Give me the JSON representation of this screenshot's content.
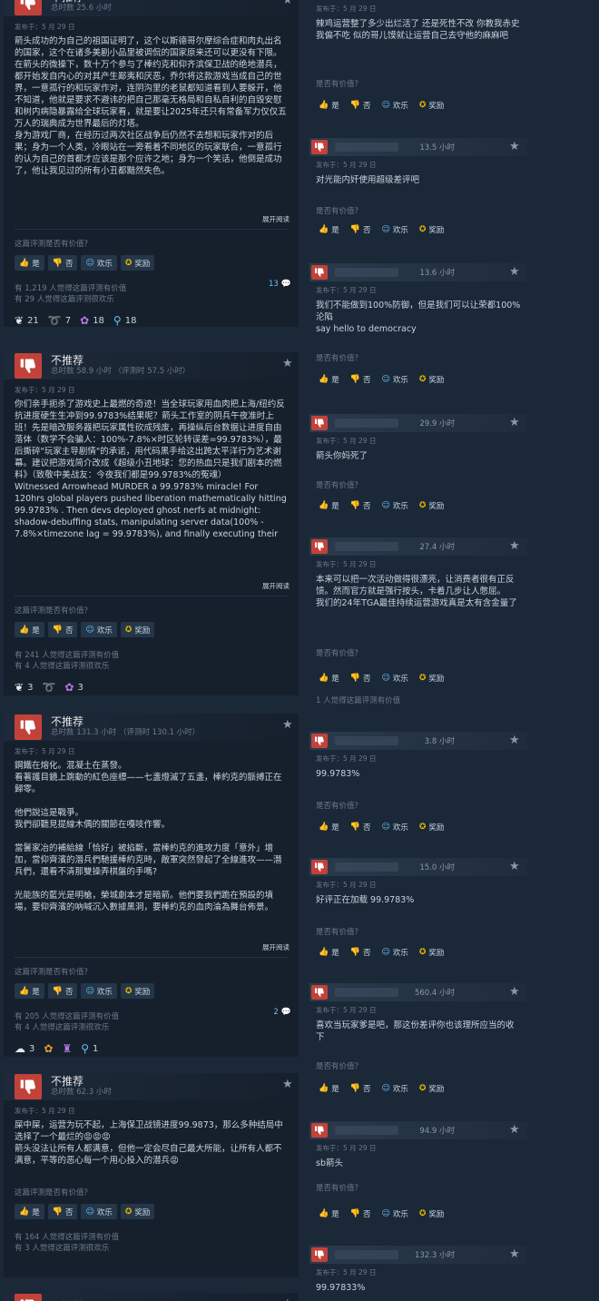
{
  "labels": {
    "verdict": "不推荐",
    "was_helpful": "这篇评测是否有价值？",
    "was_helpful_short": "是否有价值？",
    "yes": "是",
    "no": "否",
    "funny": "欢乐",
    "award": "奖励",
    "read_more": "展开阅读"
  },
  "left_reviews": [
    {
      "hours": "总时数 25.6 小时",
      "posted": "发布于：5 月 29 日",
      "text": "箭头成功的为自己的祖国证明了，这个以斯德哥尔摩综合症和肉丸出名的国家，这个在诸多美剧小品里被调侃的国家原来还可以更没有下限。\n在箭头的微操下，数十万个参与了棒约克和仰齐滨保卫战的绝地潜兵，都开始发自内心的对其产生鄙夷和厌恶，乔尔将这款游戏当成自己的世界，一意孤行的和玩家作对，连阴沟里的老鼠都知道看到人要躲开，他不知道，他就是要求不避讳的把自己那毫无格局和自私自利的自毁安慰和树内病隐暴露给全球玩家看，就是要让2025年还只有常备军力仅仅五万人的瑞典成为世界最后的灯塔。\n身为游戏厂商，在经历过两次社区战争后仍然不去想和玩家作对的后果；身为一个人类，冷眼站在一旁看着不同地区的玩家联合，一意孤行的认为自己的首都才应该是那个应许之地；身为一个笑话，他倒是成功了，他让我见过的所有小丑都黯然失色。",
      "helpful": "有 1,219 人觉得这篇评测有价值",
      "funny": "有 29 人觉得这篇评测很欢乐",
      "comments": "13",
      "awards": [
        "21",
        "7",
        "18",
        "18"
      ]
    },
    {
      "hours": "总时数 58.9 小时 （评测时 57.5 小时）",
      "posted": "发布于：5 月 29 日",
      "text": "你们亲手扼杀了游戏史上最燃的奇迹！当全球玩家用血肉把上海/纽约反抗进度硬生生冲到99.9783%结果呢？箭头工作室的阴兵午夜准时上班！先是暗改服务器把玩家属性砍成残废，再操纵后台数据让进度自由落体（数学不会骗人：100%-7.8%×时区轮转误差=99.9783%），最后撕碎\"玩家主导剧情\"的承诺，用代码黑手给这出跨太平洋行为艺术谢幕。建议把游戏简介改成《超级小丑地球：您的热血只是我们剧本的燃料》（致敬中美战友：今夜我们都是99.9783%的冤魂）\nWitnessed Arrowhead MURDER a 99.9783% miracle! For 120hrs global players pushed liberation mathematically hitting 99.9783% . Then devs deployed ghost nerfs at midnight: shadow-debuffing stats, manipulating server data(100% - 7.8%×timezone lag = 99.9783%), and finally executing their",
      "helpful": "有 241 人觉得这篇评测有价值",
      "funny": "有 4 人觉得这篇评测很欢乐",
      "comments": "",
      "awards": [
        "3",
        "",
        "3"
      ]
    },
    {
      "hours": "总时数 131.3 小时 （评测时 130.1 小时）",
      "posted": "发布于：5 月 29 日",
      "text": "鋼鐵在熔化。混凝土在蒸發。\n看著護目鏡上跳動的紅色座標——七盞燈滅了五盞，棒約克的脈搏正在歸零。\n\n他們說這是戰爭。\n我們卻聽見提線木偶的關節在嘎吱作響。\n\n當鬐家冶的補給線「恰好」被掐斷，當棒約克的進攻力度「意外」增加，當仰齊濱的潛兵們馳援棒約克時，敵軍突然發起了全線進攻——潛兵們，還看不清那雙操弄棋盤的手嗎?\n\n光能族的藍光是明槍，榮城劇本才是暗箭。他們要我們跪在預設的墳場，要仰齊濱的吶喊沉入數據黑洞，要棒約克的血肉淪為舞台佈景。",
      "helpful": "有 205 人觉得这篇评测有价值",
      "funny": "有 4 人觉得这篇评测很欢乐",
      "comments": "2",
      "awards": [
        "3",
        "",
        "",
        "1"
      ]
    },
    {
      "hours": "总时数 62.3 小时",
      "posted": "发布于：5 月 29 日",
      "text": "屎中屎，运营为玩不起，上海保卫战镜进度99.9873，那么多种结局中选择了一个最烂的😡😡😡\n箭头没法让所有人都满意，但他一定会尽自己最大所能，让所有人都不满意，平等的恶心每一个用心投入的潜兵😡",
      "helpful": "有 164 人觉得这篇评测有价值",
      "funny": "有 3 人觉得这篇评测很欢乐",
      "comments": "",
      "awards": []
    },
    {
      "hours": "",
      "posted": "",
      "text": "",
      "helpful": "",
      "funny": "",
      "comments": "",
      "awards": []
    }
  ],
  "right_reviews": [
    {
      "hours": "",
      "posted": "发布于：5 月 29 日",
      "text": "辣鸡运营整了多少出烂活了 还是死性不改 你教我赤史 我偏不吃 似的哥儿馍就让运营自己去守他的麻麻吧",
      "stat": ""
    },
    {
      "hours": "13.5 小时",
      "posted": "发布于：5 月 29 日",
      "text": "对光能内奸使用超级差评吧",
      "stat": ""
    },
    {
      "hours": "13.6 小时",
      "posted": "发布于：5 月 29 日",
      "text": "我们不能做到100%防御，但是我们可以让荣都100%沦陷\nsay hello to democracy",
      "stat": ""
    },
    {
      "hours": "29.9 小时",
      "posted": "发布于：5 月 29 日",
      "text": "箭头你妈死了",
      "stat": ""
    },
    {
      "hours": "27.4 小时",
      "posted": "发布于：5 月 29 日",
      "text": "本来可以把一次活动做得很漂亮，让消费者很有正反馈。然而官方就是强行按头，卡着几步让人憋屈。\n我们的24年TGA最佳持续运营游戏真是太有含金量了",
      "stat": "1 人觉得这篇评测有价值"
    },
    {
      "hours": "3.8 小时",
      "posted": "发布于：5 月 29 日",
      "text": "99.9783%",
      "stat": ""
    },
    {
      "hours": "15.0 小时",
      "posted": "发布于：5 月 29 日",
      "text": "好评正在加载 99.9783%",
      "stat": ""
    },
    {
      "hours": "560.4 小时",
      "posted": "发布于：5 月 29 日",
      "text": "喜欢当玩家爹是吧，那这份差评你也该理所应当的收下",
      "stat": ""
    },
    {
      "hours": "94.9 小时",
      "posted": "发布于：5 月 29 日",
      "text": "sb箭头",
      "stat": ""
    },
    {
      "hours": "132.3 小时",
      "posted": "发布于：5 月 29 日",
      "text": "99.97833%",
      "stat": ""
    }
  ],
  "colors": {
    "background": "#1b2838",
    "card": "#16202d",
    "thumb_down": "#c2423a",
    "accent": "#66c0f4"
  }
}
